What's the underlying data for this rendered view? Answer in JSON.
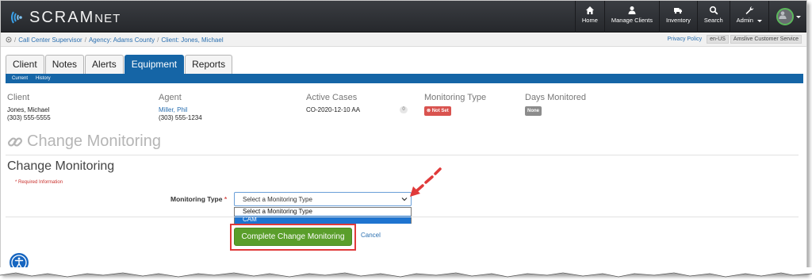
{
  "brand": {
    "name_main": "SCRAM",
    "name_suffix": "NET"
  },
  "nav": [
    {
      "label": "Home",
      "icon": "home-icon"
    },
    {
      "label": "Manage Clients",
      "icon": "user-icon"
    },
    {
      "label": "Inventory",
      "icon": "truck-icon"
    },
    {
      "label": "Search",
      "icon": "search-icon"
    },
    {
      "label": "Admin",
      "icon": "wrench-icon"
    }
  ],
  "breadcrumb": {
    "items": [
      "Call Center Supervisor",
      "Agency: Adams County",
      "Client: Jones, Michael"
    ],
    "privacy": "Privacy Policy",
    "locale": "en-US",
    "service": "Amslive Customer Service"
  },
  "tabs": [
    {
      "label": "Client"
    },
    {
      "label": "Notes"
    },
    {
      "label": "Alerts"
    },
    {
      "label": "Equipment",
      "active": true
    },
    {
      "label": "Reports"
    }
  ],
  "subtabs": [
    "Current",
    "History"
  ],
  "info": {
    "client": {
      "header": "Client",
      "name": "Jones, Michael",
      "phone": "(303) 555-5555"
    },
    "agent": {
      "header": "Agent",
      "name": "Miller, Phil",
      "phone": "(303) 555-1234"
    },
    "cases": {
      "header": "Active Cases",
      "value": "CO-2020-12-10 AA",
      "count": "0"
    },
    "monitoring": {
      "header": "Monitoring Type",
      "value": "Not Set"
    },
    "days": {
      "header": "Days Monitored",
      "value": "None"
    }
  },
  "page_title": "Change Monitoring",
  "section_title": "Change Monitoring",
  "required_note": "* Required Information",
  "form": {
    "label": "Monitoring Type",
    "required_mark": "*",
    "selected": "Select a Monitoring Type",
    "options": [
      "Select a Monitoring Type",
      "CAM"
    ],
    "highlighted_option": "CAM"
  },
  "actions": {
    "submit": "Complete Change Monitoring",
    "cancel": "Cancel"
  },
  "colors": {
    "primary": "#1565a6",
    "success": "#5a9e2b",
    "danger": "#d9534f",
    "annotation": "#e03a3a"
  }
}
